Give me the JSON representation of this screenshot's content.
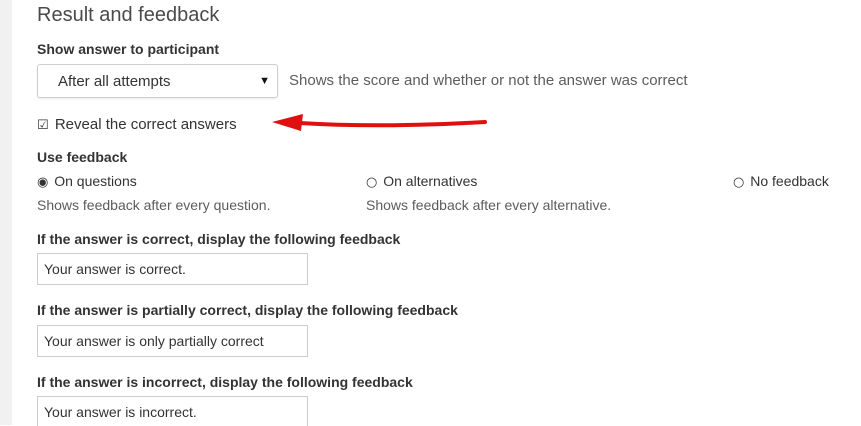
{
  "section": {
    "title": "Result and feedback"
  },
  "show_answer": {
    "label": "Show answer to participant",
    "selected": "After all attempts",
    "help": "Shows the score and whether or not the answer was correct"
  },
  "reveal": {
    "checked": true,
    "label": "Reveal the correct answers"
  },
  "use_feedback": {
    "label": "Use feedback",
    "options": [
      {
        "label": "On questions",
        "selected": true,
        "description": "Shows feedback after every question."
      },
      {
        "label": "On alternatives",
        "selected": false,
        "description": "Shows feedback after every alternative."
      },
      {
        "label": "No feedback",
        "selected": false,
        "description": ""
      }
    ]
  },
  "feedback_fields": [
    {
      "label": "If the answer is correct, display the following feedback",
      "value": "Your answer is correct."
    },
    {
      "label": "If the answer is partially correct, display the following feedback",
      "value": "Your answer is only partially correct"
    },
    {
      "label": "If the answer is incorrect, display the following feedback",
      "value": "Your answer is incorrect."
    }
  ],
  "annotation": {
    "arrow_color": "#e01010"
  }
}
